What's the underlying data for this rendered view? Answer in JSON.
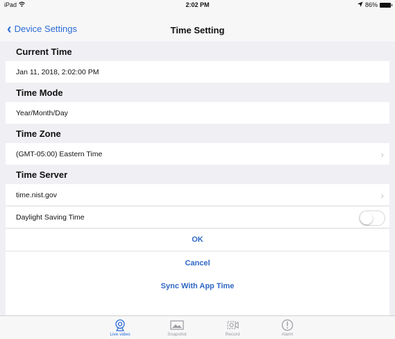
{
  "status_bar": {
    "device": "iPad",
    "time": "2:02 PM",
    "battery": "86%"
  },
  "nav": {
    "back_label": "Device Settings",
    "title": "Time Setting"
  },
  "sections": {
    "current_time": {
      "header": "Current Time",
      "value": "Jan 11, 2018, 2:02:00 PM"
    },
    "time_mode": {
      "header": "Time Mode",
      "value": "Year/Month/Day"
    },
    "time_zone": {
      "header": "Time Zone",
      "value": "(GMT-05:00) Eastern Time"
    },
    "time_server": {
      "header": "Time Server",
      "value": "time.nist.gov"
    }
  },
  "dst": {
    "label": "Daylight Saving Time",
    "enabled": false
  },
  "actions": {
    "ok": "OK",
    "cancel": "Cancel",
    "sync": "Sync With App Time"
  },
  "tabs": [
    {
      "label": "Live video",
      "icon": "camera-icon",
      "active": true
    },
    {
      "label": "Snapshot",
      "icon": "image-icon",
      "active": false
    },
    {
      "label": "Record",
      "icon": "video-record-icon",
      "active": false
    },
    {
      "label": "Alarm",
      "icon": "alert-icon",
      "active": false
    }
  ],
  "colors": {
    "accent": "#2b6cd6",
    "background": "#efeff4"
  }
}
